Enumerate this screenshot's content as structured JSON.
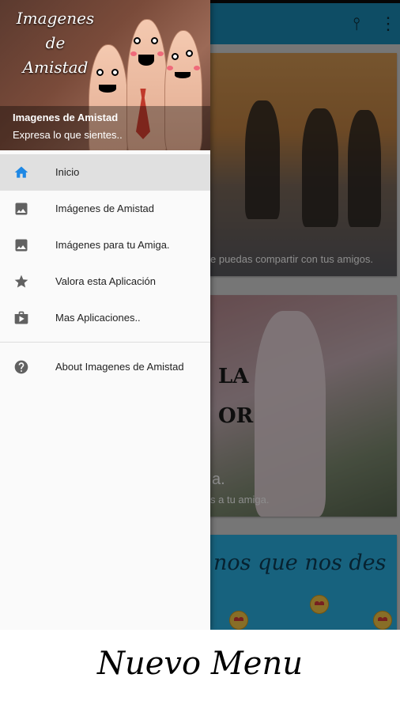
{
  "app": {
    "actions": [
      {
        "name": "share-icon",
        "glyph": "⫯"
      },
      {
        "name": "more-vert-icon",
        "glyph": "⋮"
      }
    ],
    "cards": [
      {
        "caption": "e puedas compartir con tus amigos."
      },
      {
        "big_line_1": "LA",
        "big_line_2": "OR",
        "mid_text": "a.",
        "caption": "s a tu amiga."
      },
      {
        "script_text": "nos que nos des"
      }
    ]
  },
  "drawer": {
    "header": {
      "logo_title_lines": [
        "Imagenes",
        "de",
        "Amistad"
      ],
      "name": "Imagenes de Amistad",
      "subtitle": "Expresa lo que sientes.."
    },
    "items": [
      {
        "label": "Inicio",
        "icon": "home-icon",
        "active": true
      },
      {
        "label": "Imágenes de Amistad",
        "icon": "image-icon",
        "active": false
      },
      {
        "label": "Imágenes para tu Amiga.",
        "icon": "image-icon",
        "active": false
      },
      {
        "label": "Valora esta Aplicación",
        "icon": "star-icon",
        "active": false
      },
      {
        "label": "Mas Aplicaciones..",
        "icon": "shop-icon",
        "active": false
      }
    ],
    "secondary_items": [
      {
        "label": "About Imagenes de Amistad",
        "icon": "help-icon"
      }
    ]
  },
  "caption": {
    "text": "Nuevo Menu"
  },
  "colors": {
    "app_bar": "#1a8cb8",
    "accent_icon": "#1e88e5",
    "icon_gray": "#616161",
    "active_row": "#e0e0e0"
  }
}
